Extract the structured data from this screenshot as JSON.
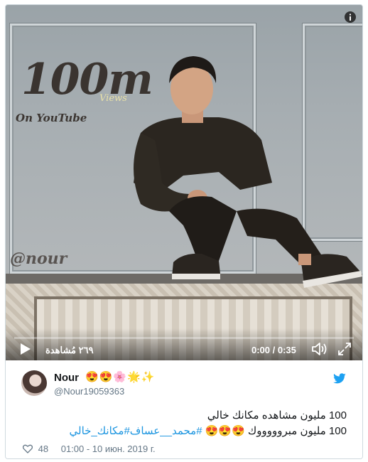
{
  "video": {
    "overlay_big_text": "100m",
    "overlay_views_text": "Views",
    "overlay_youtube_text": "On YouTube",
    "watermark": "@nour",
    "view_count": "٢٦٩ مُشاهدة",
    "time_readout": "0:00 / 0:35",
    "progress_fraction": 0
  },
  "tweet": {
    "author_name": "Nour",
    "author_emojis": "😍😍🌸🌟✨",
    "handle": "@Nour19059363",
    "line1": "100 مليون مشاهده مكانك خالي",
    "line2_text": "100 مليون مبروووووك 😍😍😍",
    "line2_hashtags": "#محمد__عساف#مكانك_خالي",
    "likes": "48",
    "timestamp": "01:00 - 10 июн. 2019 г."
  },
  "colors": {
    "accent": "#1b95e0",
    "muted": "#657786",
    "text": "#14171a"
  }
}
